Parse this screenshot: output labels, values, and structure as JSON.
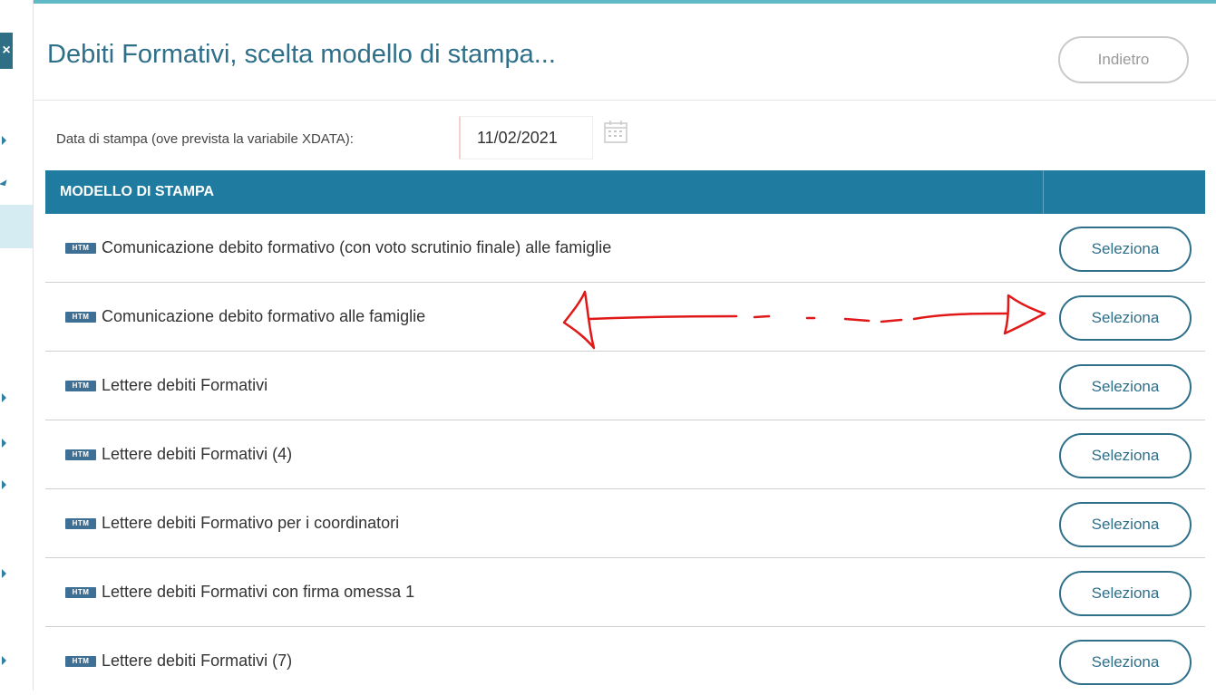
{
  "header": {
    "title": "Debiti Formativi, scelta modello di stampa...",
    "back_label": "Indietro"
  },
  "date": {
    "label": "Data di stampa (ove prevista la variabile XDATA):",
    "value": "11/02/2021"
  },
  "table": {
    "column_header": "MODELLO DI STAMPA",
    "icon_label": "HTM",
    "button_label": "Seleziona",
    "rows": [
      {
        "label": "Comunicazione debito formativo (con voto scrutinio finale) alle famiglie"
      },
      {
        "label": "Comunicazione debito formativo alle famiglie"
      },
      {
        "label": "Lettere debiti Formativi"
      },
      {
        "label": "Lettere debiti Formativi (4)"
      },
      {
        "label": "Lettere debiti Formativo per i coordinatori"
      },
      {
        "label": "Lettere debiti Formativi con firma omessa 1"
      },
      {
        "label": "Lettere debiti Formativi (7)"
      }
    ]
  },
  "colors": {
    "accent": "#1f7ba0",
    "title": "#2e6f8a",
    "annotation": "#e01818"
  }
}
